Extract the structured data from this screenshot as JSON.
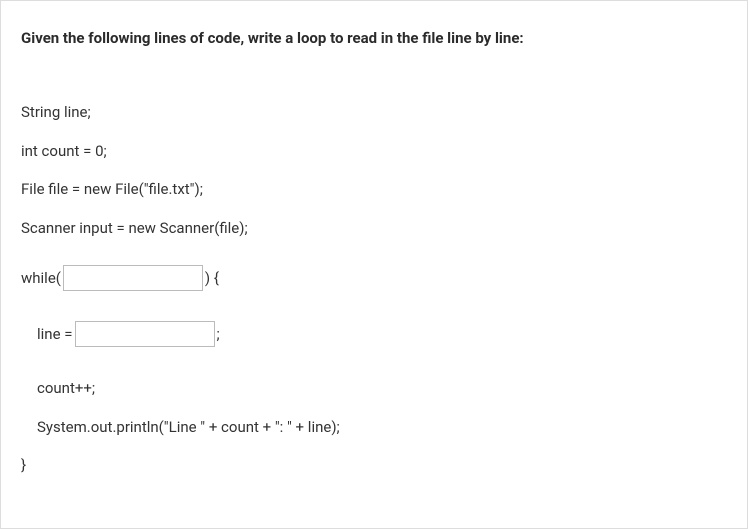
{
  "question": {
    "prompt": "Given the following lines of code, write a loop to read in the file line by line:"
  },
  "code": {
    "line1": "String line;",
    "line2": "int count = 0;",
    "line3": "File file = new File(\"file.txt\");",
    "line4": "Scanner input = new Scanner(file);",
    "while_pre": "while(",
    "while_post": ") {",
    "line_assign_pre": "line = ",
    "line_assign_post": ";",
    "count_inc": "count++;",
    "println": "System.out.println(\"Line \" + count + \": \" + line);",
    "close_brace": "}"
  },
  "inputs": {
    "blank1": "",
    "blank2": ""
  }
}
